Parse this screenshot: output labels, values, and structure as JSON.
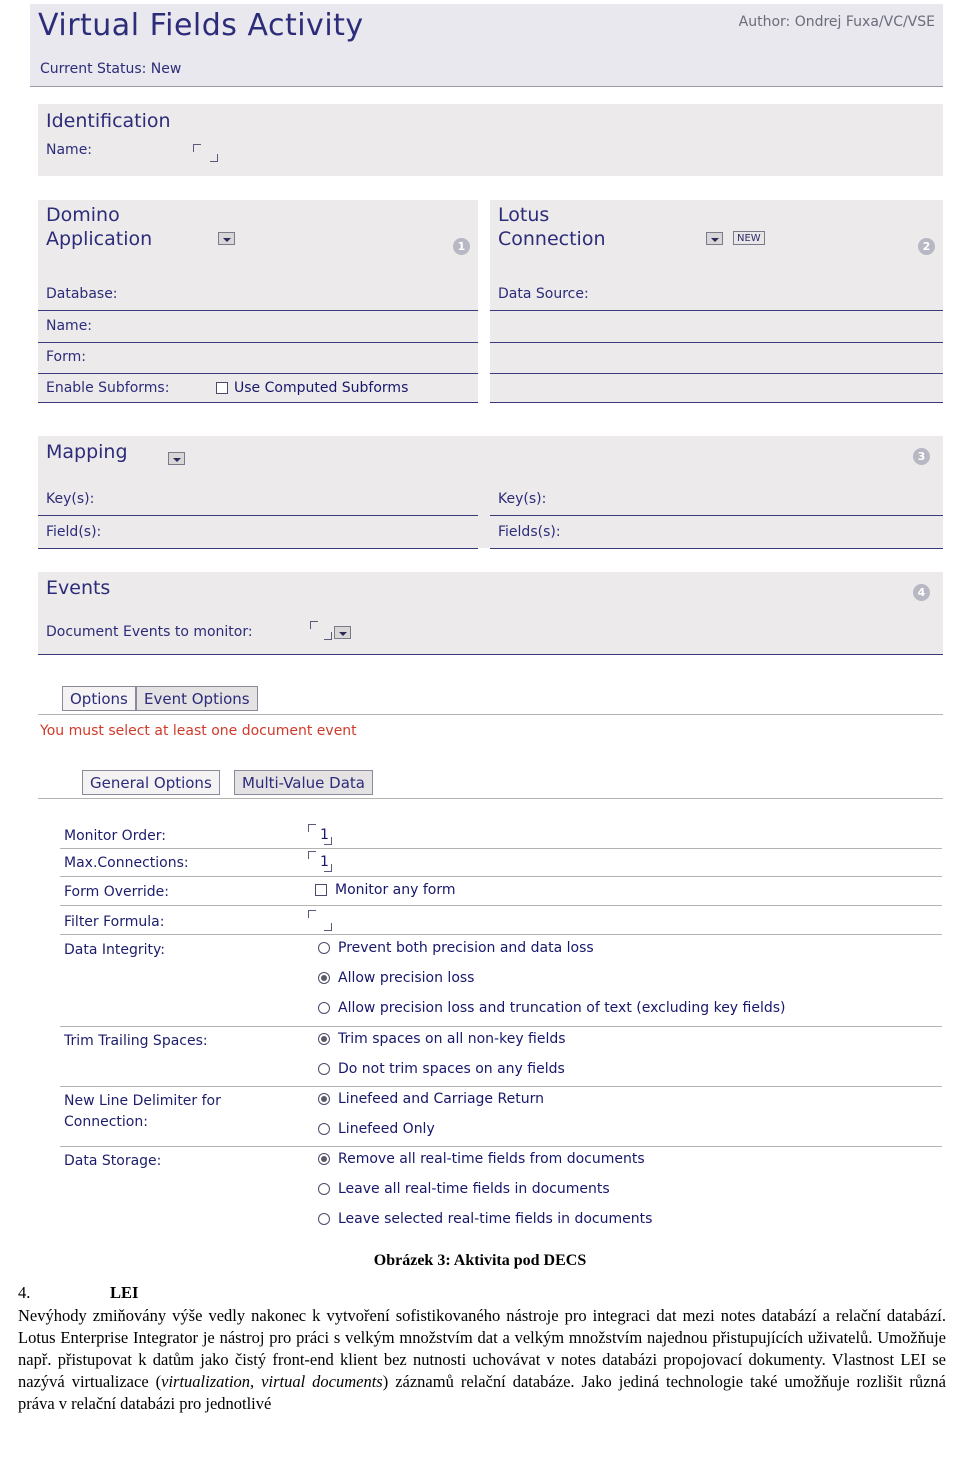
{
  "screenshot": {
    "header": {
      "title": "Virtual Fields Activity",
      "author": "Author: Ondrej Fuxa/VC/VSE",
      "status": "Current Status: New"
    },
    "identification": {
      "section_title": "Identification",
      "name_label": "Name:"
    },
    "domino_application": {
      "section_title_line1": "Domino",
      "section_title_line2": "Application",
      "badge": "1",
      "database_label": "Database:",
      "name_label": "Name:",
      "form_label": "Form:",
      "enable_subforms_label": "Enable Subforms:",
      "use_computed_subforms_label": "Use Computed Subforms"
    },
    "lotus_connection": {
      "section_title_line1": "Lotus",
      "section_title_line2": "Connection",
      "new_button": "NEW",
      "badge": "2",
      "data_source_label": "Data Source:"
    },
    "mapping": {
      "section_title": "Mapping",
      "badge": "3",
      "left_keys_label": "Key(s):",
      "left_fields_label": "Field(s):",
      "right_keys_label": "Key(s):",
      "right_fields_label": "Fields(s):"
    },
    "events": {
      "section_title": "Events",
      "badge": "4",
      "document_events_label": "Document Events to monitor:"
    },
    "tabs_top": [
      {
        "label": "Options",
        "selected": true
      },
      {
        "label": "Event Options",
        "selected": false
      }
    ],
    "warning": "You must select at least one document event",
    "tabs_sub": [
      {
        "label": "General Options",
        "selected": true
      },
      {
        "label": "Multi-Value Data",
        "selected": false
      }
    ],
    "general_options": {
      "monitor_order_label": "Monitor Order:",
      "monitor_order_value": "1",
      "max_connections_label": "Max.Connections:",
      "max_connections_value": "1",
      "form_override_label": "Form Override:",
      "monitor_any_form_label": "Monitor any form",
      "filter_formula_label": "Filter Formula:",
      "data_integrity_label": "Data Integrity:",
      "data_integrity_options": [
        {
          "label": "Prevent both precision and data loss",
          "selected": false
        },
        {
          "label": "Allow precision loss",
          "selected": true
        },
        {
          "label": "Allow precision loss and truncation of text (excluding key fields)",
          "selected": false
        }
      ],
      "trim_trailing_label": "Trim Trailing Spaces:",
      "trim_options": [
        {
          "label": "Trim spaces on all non-key fields",
          "selected": true
        },
        {
          "label": "Do not trim spaces on any fields",
          "selected": false
        }
      ],
      "new_line_label_line1": "New Line Delimiter for",
      "new_line_label_line2": "Connection:",
      "new_line_options": [
        {
          "label": "Linefeed and Carriage Return",
          "selected": true
        },
        {
          "label": "Linefeed Only",
          "selected": false
        }
      ],
      "data_storage_label": "Data Storage:",
      "data_storage_options": [
        {
          "label": "Remove all real-time fields from documents",
          "selected": true
        },
        {
          "label": "Leave all real-time fields in documents",
          "selected": false
        },
        {
          "label": "Leave selected real-time fields in documents",
          "selected": false
        }
      ]
    }
  },
  "caption": "Obrázek 3: Aktivita pod DECS",
  "section": {
    "number": "4.",
    "title": "LEI"
  },
  "paragraph": "Nevýhody zmiňovány výše vedly nakonec k vytvoření sofistikovaného nástroje pro integraci dat mezi notes databází a relační databází. Lotus Enterprise Integrator je nástroj pro práci s velkým množstvím dat a velkým množstvím najednou přistupujících uživatelů. Umožňuje např. přistupovat k datům jako čistý front-end klient bez nutnosti uchovávat v notes databázi propojovací dokumenty. Vlastnost LEI se nazývá virtualizace (",
  "paragraph_italic": "virtualization, virtual documents",
  "paragraph_tail": ") záznamů relační databáze. Jako jediná technologie také umožňuje rozlišit různá práva v relační databázi pro jednotlivé"
}
